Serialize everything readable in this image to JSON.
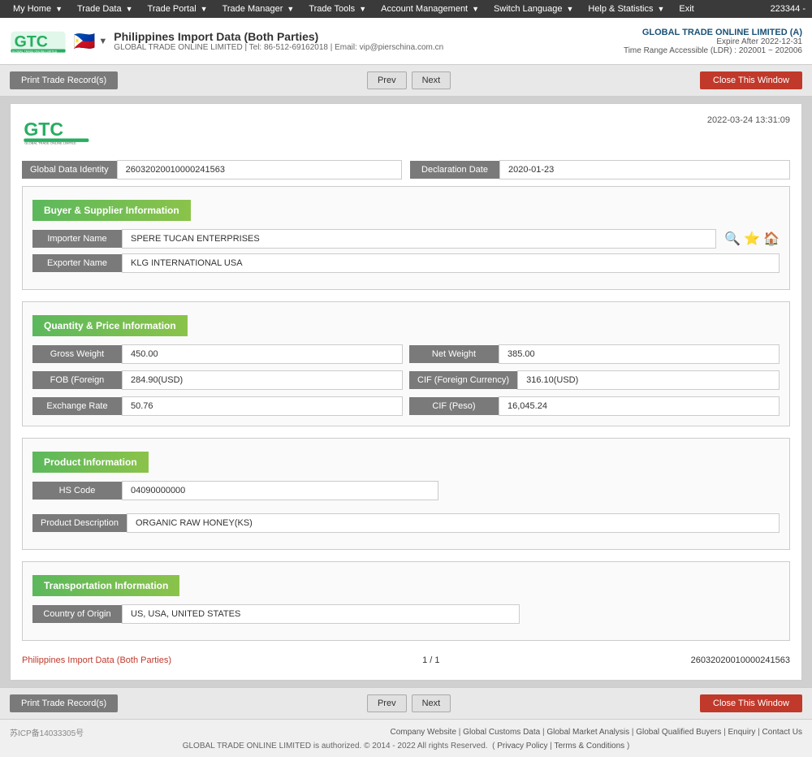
{
  "topnav": {
    "items": [
      {
        "label": "My Home",
        "id": "my-home"
      },
      {
        "label": "Trade Data",
        "id": "trade-data"
      },
      {
        "label": "Trade Portal",
        "id": "trade-portal"
      },
      {
        "label": "Trade Manager",
        "id": "trade-manager"
      },
      {
        "label": "Trade Tools",
        "id": "trade-tools"
      },
      {
        "label": "Account Management",
        "id": "account-management"
      },
      {
        "label": "Switch Language",
        "id": "switch-language"
      },
      {
        "label": "Help & Statistics",
        "id": "help-statistics"
      },
      {
        "label": "Exit",
        "id": "exit"
      }
    ],
    "user_id": "223344 -"
  },
  "header": {
    "flag_emoji": "🇵🇭",
    "title": "Philippines Import Data (Both Parties)",
    "subtitle": "GLOBAL TRADE ONLINE LIMITED | Tel: 86-512-69162018 | Email: vip@pierschina.com.cn",
    "company_name": "GLOBAL TRADE ONLINE LIMITED (A)",
    "expire": "Expire After 2022-12-31",
    "time_range": "Time Range Accessible (LDR) : 202001 ~ 202006"
  },
  "toolbar": {
    "print_label": "Print Trade Record(s)",
    "prev_label": "Prev",
    "next_label": "Next",
    "close_label": "Close This Window"
  },
  "record": {
    "datetime": "2022-03-24 13:31:09",
    "global_data_identity_label": "Global Data Identity",
    "global_data_identity_value": "26032020010000241563",
    "declaration_date_label": "Declaration Date",
    "declaration_date_value": "2020-01-23",
    "buyer_supplier_section": "Buyer & Supplier Information",
    "importer_name_label": "Importer Name",
    "importer_name_value": "SPERE TUCAN ENTERPRISES",
    "exporter_name_label": "Exporter Name",
    "exporter_name_value": "KLG INTERNATIONAL USA",
    "quantity_section": "Quantity & Price Information",
    "gross_weight_label": "Gross Weight",
    "gross_weight_value": "450.00",
    "net_weight_label": "Net Weight",
    "net_weight_value": "385.00",
    "fob_label": "FOB (Foreign",
    "fob_value": "284.90(USD)",
    "cif_foreign_label": "CIF (Foreign Currency)",
    "cif_foreign_value": "316.10(USD)",
    "exchange_rate_label": "Exchange Rate",
    "exchange_rate_value": "50.76",
    "cif_peso_label": "CIF (Peso)",
    "cif_peso_value": "16,045.24",
    "product_section": "Product Information",
    "hs_code_label": "HS Code",
    "hs_code_value": "04090000000",
    "product_desc_label": "Product Description",
    "product_desc_value": "ORGANIC RAW HONEY(KS)",
    "transport_section": "Transportation Information",
    "country_of_origin_label": "Country of Origin",
    "country_of_origin_value": "US, USA, UNITED STATES",
    "footer_link": "Philippines Import Data (Both Parties)",
    "footer_page": "1 / 1",
    "footer_id": "26032020010000241563"
  },
  "bottom_toolbar": {
    "print_label": "Print Trade Record(s)",
    "prev_label": "Prev",
    "next_label": "Next",
    "close_label": "Close This Window"
  },
  "page_footer": {
    "icp": "苏ICP备14033305号",
    "links": [
      "Company Website",
      "Global Customs Data",
      "Global Market Analysis",
      "Global Qualified Buyers",
      "Enquiry",
      "Contact Us"
    ],
    "copyright": "GLOBAL TRADE ONLINE LIMITED is authorized. © 2014 - 2022 All rights Reserved.",
    "privacy": "Privacy Policy",
    "terms": "Terms & Conditions"
  },
  "icons": {
    "search": "🔍",
    "star": "⭐",
    "home": "🏠"
  }
}
